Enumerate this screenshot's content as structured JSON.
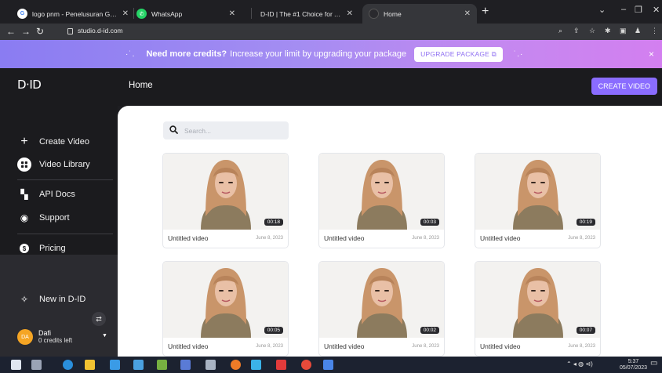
{
  "browser": {
    "tabs": [
      {
        "title": "logo pnm - Penelusuran Google",
        "active": false
      },
      {
        "title": "WhatsApp",
        "active": false
      },
      {
        "title": "D-ID | The #1 Choice for AI Gener",
        "active": false
      },
      {
        "title": "Home",
        "active": true
      }
    ],
    "new_tab": "+",
    "url": "studio.d-id.com"
  },
  "banner": {
    "headline": "Need more credits?",
    "text": "Increase your limit by upgrading your package",
    "button": "UPGRADE PACKAGE ⧉",
    "close": "×"
  },
  "header": {
    "logo": "D·ID",
    "title": "Home",
    "create_button": "CREATE VIDEO"
  },
  "sidebar": {
    "items": [
      {
        "label": "Create Video",
        "icon": "plus-icon"
      },
      {
        "label": "Video Library",
        "icon": "grid-icon"
      },
      {
        "label": "API Docs",
        "icon": "document-icon"
      },
      {
        "label": "Support",
        "icon": "support-icon"
      },
      {
        "label": "Pricing",
        "icon": "dollar-icon"
      },
      {
        "label": "New in D-ID",
        "icon": "sparkle-icon"
      }
    ],
    "user": {
      "initials": "DA",
      "name": "Dafi",
      "credits": "0 credits left"
    }
  },
  "search": {
    "placeholder": "Search..."
  },
  "videos": [
    {
      "title": "Untitled video",
      "date": "June 8, 2023",
      "duration": "00:18"
    },
    {
      "title": "Untitled video",
      "date": "June 8, 2023",
      "duration": "00:03"
    },
    {
      "title": "Untitled video",
      "date": "June 8, 2023",
      "duration": "00:19"
    },
    {
      "title": "Untitled video",
      "date": "June 8, 2023",
      "duration": "00:05"
    },
    {
      "title": "Untitled video",
      "date": "June 8, 2023",
      "duration": "00:02"
    },
    {
      "title": "Untitled video",
      "date": "June 8, 2023",
      "duration": "00:07"
    }
  ],
  "taskbar": {
    "time": "5:37",
    "date": "05/07/2023"
  },
  "colors": {
    "accent": "#8a6cff",
    "banner_start": "#8a7cf2",
    "banner_end": "#d37ff0",
    "sidebar": "#1b1b1e"
  }
}
